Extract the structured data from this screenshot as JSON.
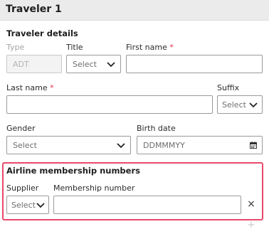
{
  "header": {
    "title": "Traveler 1"
  },
  "traveler_details": {
    "heading": "Traveler details",
    "type": {
      "label": "Type",
      "value": "ADT"
    },
    "title": {
      "label": "Title",
      "selected": "Select"
    },
    "first_name": {
      "label": "First name",
      "required_mark": "*",
      "value": ""
    },
    "last_name": {
      "label": "Last name",
      "required_mark": "*",
      "value": ""
    },
    "suffix": {
      "label": "Suffix",
      "selected": "Select"
    },
    "gender": {
      "label": "Gender",
      "selected": "Select"
    },
    "birth_date": {
      "label": "Birth date",
      "placeholder": "DDMMMYY"
    }
  },
  "airline_membership": {
    "heading": "Airline membership numbers",
    "supplier": {
      "label": "Supplier",
      "selected": "Select"
    },
    "membership_number": {
      "label": "Membership number",
      "value": ""
    },
    "clear_glyph": "×",
    "add_glyph": "+"
  },
  "colors": {
    "highlight_border": "#e84a6a",
    "required": "#e0304a",
    "header_bg": "#ebebeb"
  },
  "icons": [
    "chevron-down-icon",
    "calendar-icon",
    "close-icon",
    "plus-icon"
  ]
}
